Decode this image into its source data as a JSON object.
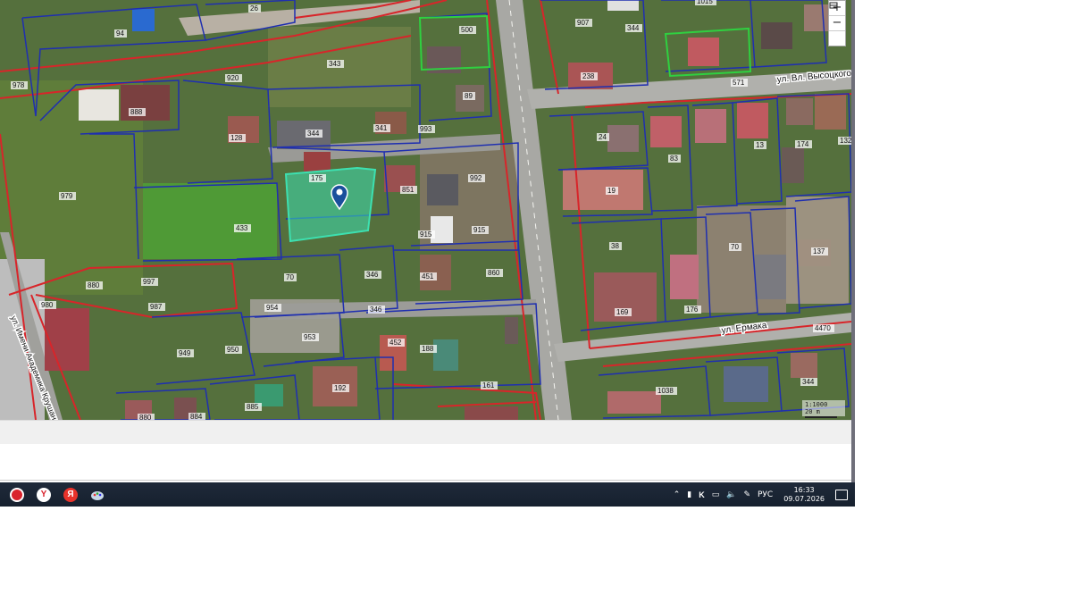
{
  "map": {
    "streets": [
      "ул. Вл. Высоцкого",
      "ул. Ермака",
      "ул. Имени Академика Крушанова"
    ],
    "zoom_in": "+",
    "zoom_out": "−",
    "layers_icon": "layers-icon",
    "scale_ratio": "1:1000",
    "scale_length": "20 m",
    "parcel_labels": [
      {
        "t": "94"
      },
      {
        "t": "26"
      },
      {
        "t": "500"
      },
      {
        "t": "907"
      },
      {
        "t": "344"
      },
      {
        "t": "1015"
      },
      {
        "t": "978"
      },
      {
        "t": "920"
      },
      {
        "t": "343"
      },
      {
        "t": "888"
      },
      {
        "t": "89"
      },
      {
        "t": "238"
      },
      {
        "t": "571"
      },
      {
        "t": "128"
      },
      {
        "t": "344"
      },
      {
        "t": "341"
      },
      {
        "t": "993"
      },
      {
        "t": "24"
      },
      {
        "t": "83"
      },
      {
        "t": "13"
      },
      {
        "t": "174"
      },
      {
        "t": "132"
      },
      {
        "t": "175"
      },
      {
        "t": "851"
      },
      {
        "t": "992"
      },
      {
        "t": "19"
      },
      {
        "t": "979"
      },
      {
        "t": "433"
      },
      {
        "t": "915"
      },
      {
        "t": "915"
      },
      {
        "t": "38"
      },
      {
        "t": "70"
      },
      {
        "t": "137"
      },
      {
        "t": "880"
      },
      {
        "t": "997"
      },
      {
        "t": "70"
      },
      {
        "t": "346"
      },
      {
        "t": "451"
      },
      {
        "t": "860"
      },
      {
        "t": "987"
      },
      {
        "t": "980"
      },
      {
        "t": "954"
      },
      {
        "t": "346"
      },
      {
        "t": "169"
      },
      {
        "t": "176"
      },
      {
        "t": "953"
      },
      {
        "t": "4470"
      },
      {
        "t": "949"
      },
      {
        "t": "950"
      },
      {
        "t": "452"
      },
      {
        "t": "188"
      },
      {
        "t": "161"
      },
      {
        "t": "192"
      },
      {
        "t": "1038"
      },
      {
        "t": "344"
      },
      {
        "t": "880"
      },
      {
        "t": "885"
      },
      {
        "t": "884"
      }
    ]
  },
  "taskbar": {
    "apps": [
      "tpc-app",
      "yandex-browser",
      "yandex",
      "paint-app"
    ],
    "tray_lang": "РУС",
    "time": "16:33",
    "date": "09.07.2026"
  },
  "colors": {
    "cadastral_blue": "#1f2fb0",
    "zone_red": "#d8252a",
    "selected_parcel": "#3de0b0",
    "taskbar": "#1c2635"
  }
}
